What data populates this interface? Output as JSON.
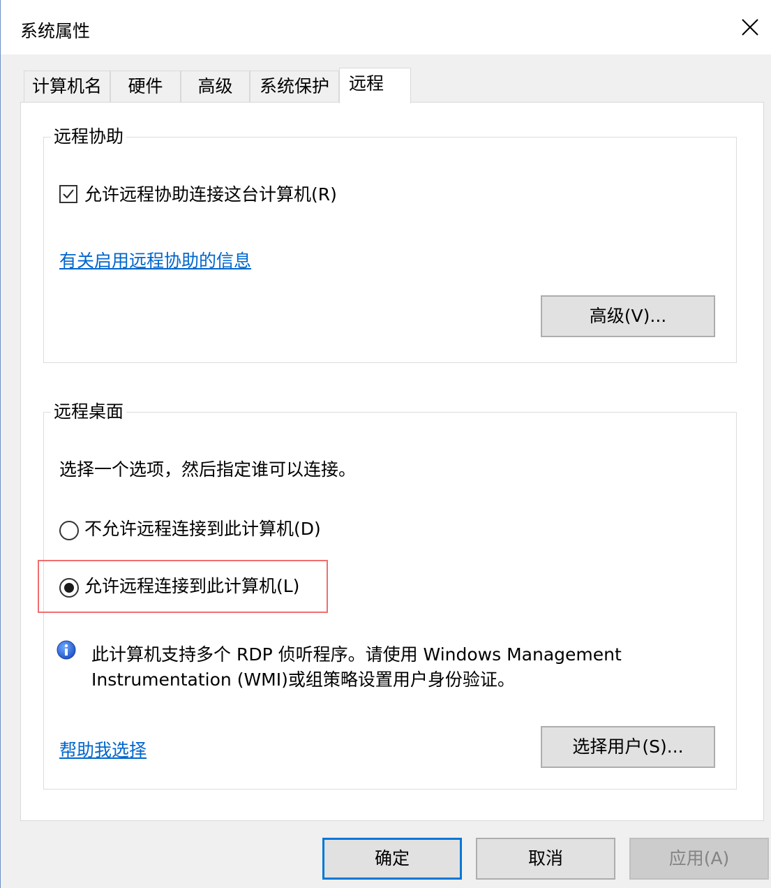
{
  "window": {
    "title": "系统属性",
    "close_icon": "close-icon"
  },
  "tabs": [
    {
      "label": "计算机名",
      "active": false
    },
    {
      "label": "硬件",
      "active": false
    },
    {
      "label": "高级",
      "active": false
    },
    {
      "label": "系统保护",
      "active": false
    },
    {
      "label": "远程",
      "active": true
    }
  ],
  "remote_assistance": {
    "group_label": "远程协助",
    "allow_checkbox_label": "允许远程协助连接这台计算机(R)",
    "allow_checked": true,
    "info_link": "有关启用远程协助的信息",
    "advanced_button": "高级(V)..."
  },
  "remote_desktop": {
    "group_label": "远程桌面",
    "instruction": "选择一个选项，然后指定谁可以连接。",
    "options": [
      {
        "label": "不允许远程连接到此计算机(D)",
        "selected": false
      },
      {
        "label": "允许远程连接到此计算机(L)",
        "selected": true
      }
    ],
    "info_icon": "info-icon",
    "info_line1": "此计算机支持多个 RDP 侦听程序。请使用 Windows Management",
    "info_line2": "Instrumentation (WMI)或组策略设置用户身份验证。",
    "help_link": "帮助我选择",
    "select_users_button": "选择用户(S)..."
  },
  "footer": {
    "ok_button": "确定",
    "cancel_button": "取消",
    "apply_button": "应用(A)",
    "apply_disabled": true
  },
  "colors": {
    "link": "#0066cc",
    "default_button_border": "#0078d7",
    "highlight": "#f06e6e"
  }
}
